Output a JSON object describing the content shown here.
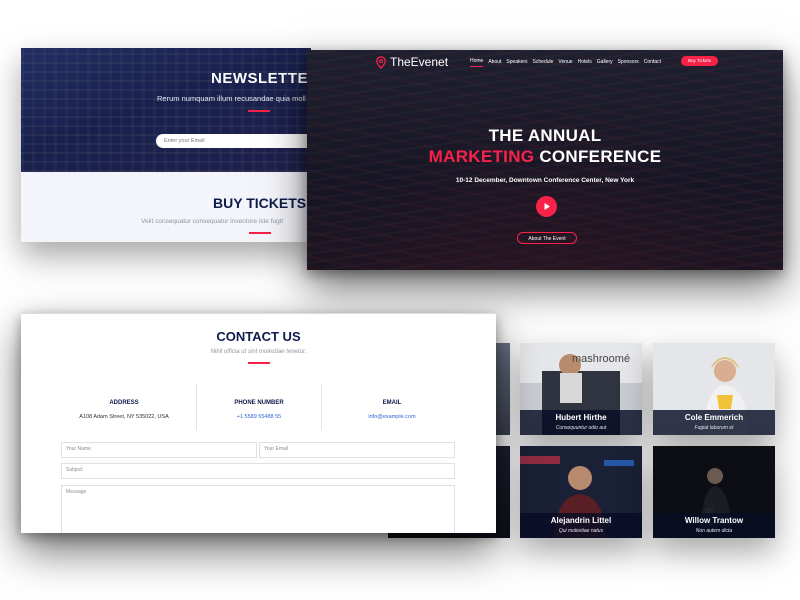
{
  "newsletter": {
    "title": "NEWSLETTER",
    "subtitle": "Rerum numquam illum recusandae quia moll",
    "email_placeholder": "Enter your Email"
  },
  "tickets": {
    "title": "BUY TICKETS",
    "subtitle": "Velit consequatur consequatur inventore iste fugit"
  },
  "hero": {
    "logo_text": "TheEvenet",
    "nav": [
      "Home",
      "About",
      "Speakers",
      "Schedule",
      "Venue",
      "Hotels",
      "Gallery",
      "Sponsors",
      "Contact"
    ],
    "active_nav": "Home",
    "buy_button": "Buy Tickets",
    "title_line1": "THE ANNUAL",
    "title_accent": "MARKETING",
    "title_rest": " CONFERENCE",
    "subtitle": "10-12 December, Downtown Conference Center, New York",
    "about_button": "About The Event",
    "accent_color": "#f82249"
  },
  "speakers": [
    {
      "name": "Hubert Hirthe",
      "role": "Consequuntur odio aut"
    },
    {
      "name": "Cole Emmerich",
      "role": "Fugiat laborum et"
    },
    {
      "name": "Alejandrin Littel",
      "role": "Qui molestiae natus"
    },
    {
      "name": "Willow Trantow",
      "role": "Non autem dicta"
    }
  ],
  "speaker_sign_text": "mashroomé",
  "contact": {
    "title": "CONTACT US",
    "subtitle": "Nihil officia ut sint molestiae tenetur.",
    "address_title": "ADDRESS",
    "address_value": "A108 Adam Street, NY 535022, USA",
    "phone_title": "PHONE NUMBER",
    "phone_value": "+1 5589 55488 55",
    "email_title": "EMAIL",
    "email_value": "info@example.com",
    "name_placeholder": "Your Name",
    "email_placeholder": "Your Email",
    "subject_placeholder": "Subject",
    "message_placeholder": "Message"
  }
}
